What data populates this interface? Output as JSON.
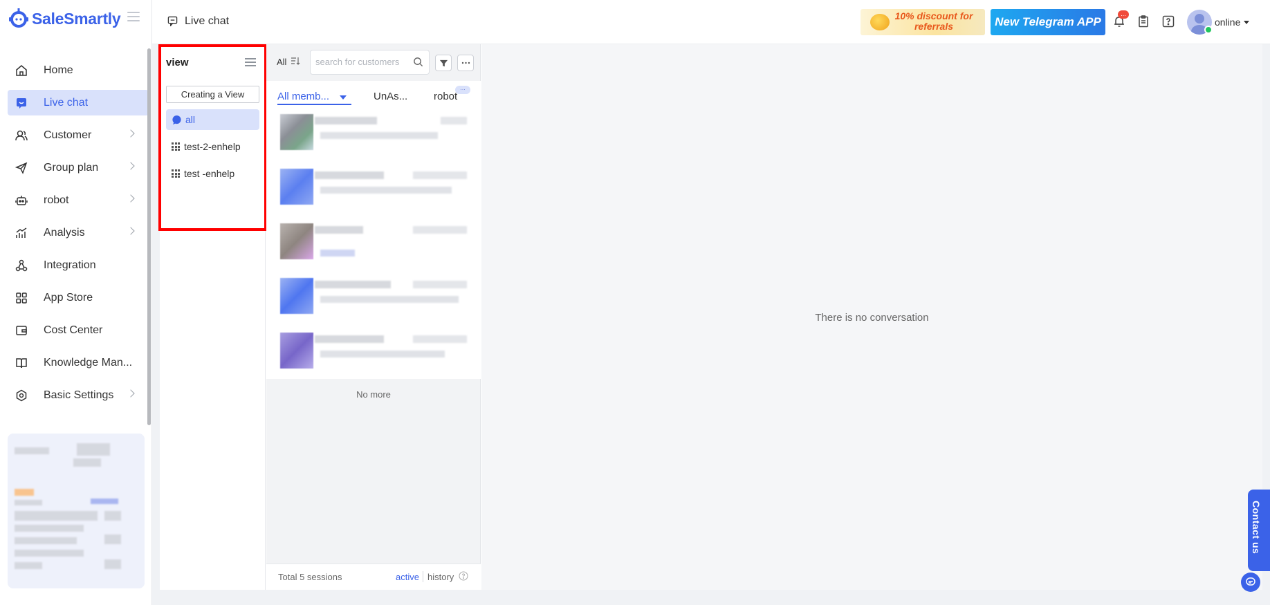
{
  "app": {
    "name": "SaleSmartly",
    "brand_color": "#3b62e8"
  },
  "nav": {
    "items": [
      {
        "key": "home",
        "label": "Home",
        "icon": "home-icon",
        "arrow": false
      },
      {
        "key": "live-chat",
        "label": "Live chat",
        "icon": "chat-icon",
        "arrow": false,
        "active": true
      },
      {
        "key": "customer",
        "label": "Customer",
        "icon": "users-icon",
        "arrow": true
      },
      {
        "key": "group-plan",
        "label": "Group plan",
        "icon": "send-icon",
        "arrow": true
      },
      {
        "key": "robot",
        "label": "robot",
        "icon": "robot-icon",
        "arrow": true
      },
      {
        "key": "analysis",
        "label": "Analysis",
        "icon": "chart-icon",
        "arrow": true
      },
      {
        "key": "integration",
        "label": "Integration",
        "icon": "integration-icon",
        "arrow": false
      },
      {
        "key": "app-store",
        "label": "App Store",
        "icon": "grid-icon",
        "arrow": false
      },
      {
        "key": "cost-center",
        "label": "Cost Center",
        "icon": "wallet-icon",
        "arrow": false
      },
      {
        "key": "knowledge",
        "label": "Knowledge Man...",
        "icon": "book-icon",
        "arrow": false
      },
      {
        "key": "basic-settings",
        "label": "Basic Settings",
        "icon": "gear-icon",
        "arrow": true
      }
    ]
  },
  "header": {
    "breadcrumb": "Live chat",
    "promo_referral": "10% discount for referrals",
    "promo_telegram": "New Telegram APP",
    "notification_badge": "...",
    "status": "online"
  },
  "views": {
    "title": "view",
    "create_label": "Creating a View",
    "items": [
      {
        "label": "all",
        "active": true
      },
      {
        "label": "test-2-enhelp"
      },
      {
        "label": "test -enhelp"
      }
    ]
  },
  "sessions": {
    "filter_label": "All",
    "search_placeholder": "search for customers",
    "tabs": [
      "All memb...",
      "UnAs...",
      "robot"
    ],
    "more_badge": "...",
    "no_more": "No more",
    "total": "Total 5 sessions",
    "active_link": "active",
    "history_link": "history"
  },
  "conversation": {
    "empty_text": "There is no conversation"
  },
  "contact": {
    "label": "Contact us"
  }
}
